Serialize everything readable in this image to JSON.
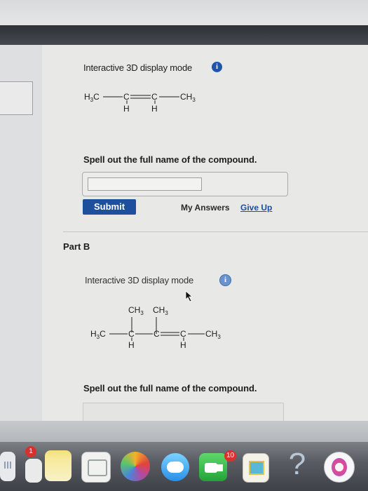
{
  "part_a": {
    "display_mode_label": "Interactive 3D display mode",
    "info_glyph": "i",
    "structure": {
      "left_group": "H3C",
      "right_group": "CH3",
      "carbon": "C",
      "hydrogen": "H"
    },
    "prompt": "Spell out the full name of the compound.",
    "answer_value": "",
    "submit_label": "Submit",
    "my_answers_label": "My Answers",
    "give_up_label": "Give Up"
  },
  "part_b": {
    "title": "Part B",
    "display_mode_label": "Interactive 3D display mode",
    "info_glyph": "i",
    "structure": {
      "left_group": "H3C",
      "right_group": "CH3",
      "top_groups": [
        "CH3",
        "CH3"
      ],
      "carbon": "C",
      "hydrogen": "H"
    },
    "prompt": "Spell out the full name of the compound."
  },
  "dock": {
    "mail_badge": "1",
    "messages_badge": "10",
    "help_glyph": "?",
    "icons": [
      "finder-icon",
      "mail-icon",
      "notes-icon",
      "calendar-icon",
      "photos-icon",
      "messages-icon",
      "facetime-icon",
      "preview-icon",
      "help-icon",
      "itunes-icon"
    ]
  },
  "colors": {
    "submit_bg": "#1d4f9c",
    "link_blue": "#1c4ea0",
    "info_blue": "#1f55a8"
  }
}
